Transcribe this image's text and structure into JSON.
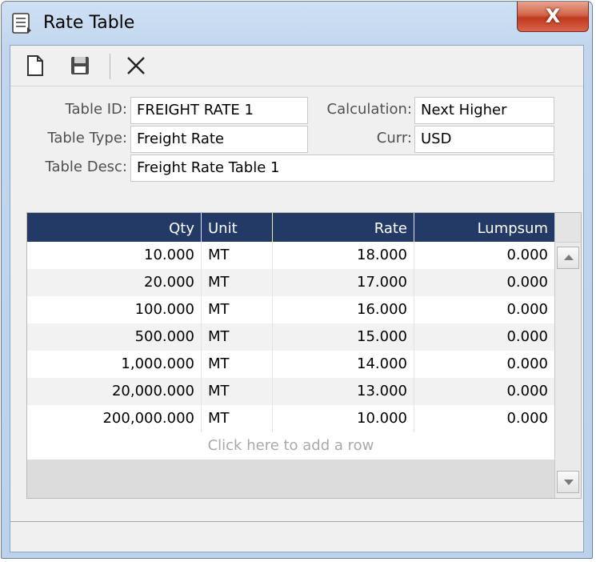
{
  "window": {
    "title": "Rate Table",
    "close_glyph": "X"
  },
  "toolbar": {
    "items": [
      {
        "icon": "new-document-icon"
      },
      {
        "icon": "save-icon"
      },
      {
        "icon": "delete-x-icon"
      }
    ]
  },
  "form": {
    "table_id_label": "Table ID:",
    "table_id_value": "FREIGHT RATE 1",
    "table_type_label": "Table Type:",
    "table_type_value": "Freight Rate",
    "table_desc_label": "Table Desc:",
    "table_desc_value": "Freight Rate Table 1",
    "calculation_label": "Calculation:",
    "calculation_value": "Next Higher",
    "curr_label": "Curr:",
    "curr_value": "USD"
  },
  "grid": {
    "columns": [
      "Qty",
      "Unit",
      "Rate",
      "Lumpsum"
    ],
    "rows": [
      [
        "10.000",
        "MT",
        "18.000",
        "0.000"
      ],
      [
        "20.000",
        "MT",
        "17.000",
        "0.000"
      ],
      [
        "100.000",
        "MT",
        "16.000",
        "0.000"
      ],
      [
        "500.000",
        "MT",
        "15.000",
        "0.000"
      ],
      [
        "1,000.000",
        "MT",
        "14.000",
        "0.000"
      ],
      [
        "20,000.000",
        "MT",
        "13.000",
        "0.000"
      ],
      [
        "200,000.000",
        "MT",
        "10.000",
        "0.000"
      ]
    ],
    "add_row_text": "Click here to add a row"
  },
  "colors": {
    "header_bg": "#233a66",
    "close_button": "#c1391e",
    "frame": "#c1d6ee"
  }
}
